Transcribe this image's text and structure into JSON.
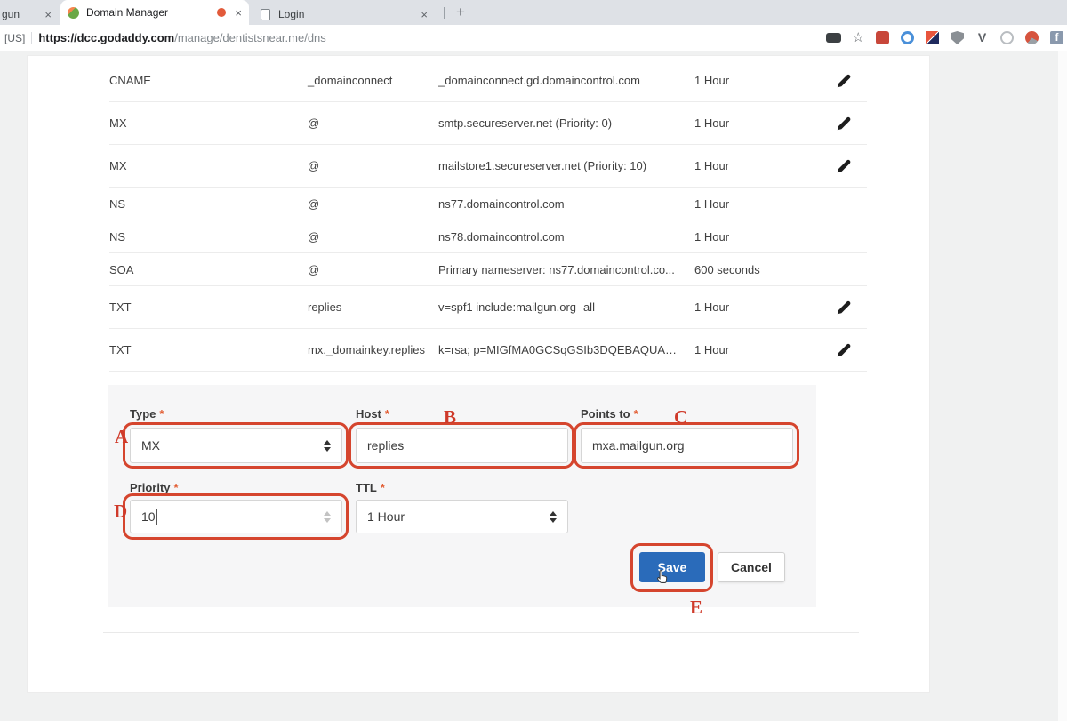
{
  "browser": {
    "tab_partial": {
      "label": "gun",
      "close": "×"
    },
    "tab_active": {
      "label": "Domain Manager",
      "close": "×"
    },
    "tab_login": {
      "label": "Login",
      "close": "×"
    },
    "newtab": "+",
    "address": {
      "region": "[US]",
      "url_main": "https://dcc.godaddy.com",
      "url_path": "/manage/dentistsnear.me/dns"
    },
    "star": "☆",
    "ext_v_glyph": "V",
    "ext_fb_glyph": "f"
  },
  "table": {
    "rows": [
      {
        "type": "CNAME",
        "name": "_domainconnect",
        "value": "_domainconnect.gd.domaincontrol.com",
        "ttl": "1 Hour"
      },
      {
        "type": "MX",
        "name": "@",
        "value": "smtp.secureserver.net (Priority: 0)",
        "ttl": "1 Hour"
      },
      {
        "type": "MX",
        "name": "@",
        "value": "mailstore1.secureserver.net (Priority: 10)",
        "ttl": "1 Hour"
      },
      {
        "type": "NS",
        "name": "@",
        "value": "ns77.domaincontrol.com",
        "ttl": "1 Hour"
      },
      {
        "type": "NS",
        "name": "@",
        "value": "ns78.domaincontrol.com",
        "ttl": "1 Hour"
      },
      {
        "type": "SOA",
        "name": "@",
        "value": "Primary nameserver: ns77.domaincontrol.co...",
        "ttl": "600 seconds"
      },
      {
        "type": "TXT",
        "name": "replies",
        "value": "v=spf1 include:mailgun.org -all",
        "ttl": "1 Hour"
      },
      {
        "type": "TXT",
        "name": "mx._domainkey.replies",
        "value": "k=rsa; p=MIGfMA0GCSqGSIb3DQEBAQUAA...",
        "ttl": "1 Hour"
      }
    ]
  },
  "form": {
    "required_mark": "*",
    "type_label": "Type",
    "type_value": "MX",
    "host_label": "Host",
    "host_value": "replies",
    "points_label": "Points to",
    "points_value": "mxa.mailgun.org",
    "priority_label": "Priority",
    "priority_value": "10",
    "ttl_label": "TTL",
    "ttl_value": "1 Hour",
    "save_label": "Save",
    "cancel_label": "Cancel"
  },
  "annotations": {
    "a": "A",
    "b": "B",
    "c": "C",
    "d": "D",
    "e": "E"
  },
  "colors": {
    "annotation_red": "#cf3a2a",
    "save_blue": "#2a6bba",
    "record_dot": "#e25a3a"
  }
}
